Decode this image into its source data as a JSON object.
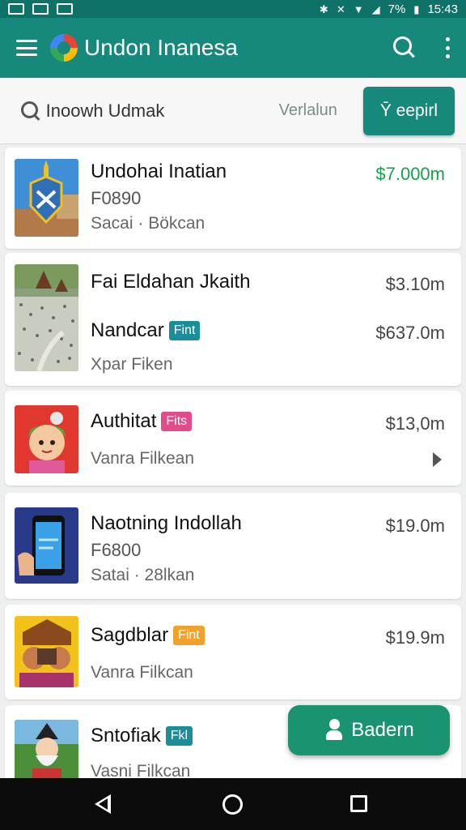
{
  "status_bar": {
    "left_icons": [
      "image-notification-icon",
      "n-notification-icon",
      "cast-notification-icon"
    ],
    "battery": "7%",
    "time": "15:43"
  },
  "app_bar": {
    "title": "Undon Inanesa",
    "icons": [
      "menu-icon",
      "app-logo-icon",
      "search-icon",
      "more-vert-icon"
    ]
  },
  "search": {
    "placeholder": "Inoowh Udmak",
    "filter_label": "Verlalun",
    "button_label": "Ȳ eepirl"
  },
  "listings": [
    {
      "title": "Undohai Inatian",
      "line2": "F0890",
      "line3": "Sacai · Bökcan",
      "price": "$7.000m",
      "price_color": "#13a34b"
    },
    {
      "title": "Fai Eldahan Jkaith",
      "price": "$3.10m",
      "line2": "Nandcar",
      "badge": "Fint",
      "badge_color": "#1a8f9a",
      "price2": "$637.0m",
      "line3": "Xpar Fiken"
    },
    {
      "title": "Authitat",
      "badge": "Fits",
      "badge_color": "#e24b8a",
      "price": "$13,0m",
      "line3": "Vanra Filkean",
      "trailing_icon": "chevron-right-icon"
    },
    {
      "title": "Naotning Indollah",
      "price": "$19.0m",
      "line2": "F6800",
      "line3": "Satai · 28lkan"
    },
    {
      "title": "Sagdblar",
      "badge": "Fint",
      "badge_color": "#f0a22a",
      "price": "$19.9m",
      "line3": "Vanra Filkcan"
    },
    {
      "title": "Sntofiak",
      "badge": "Fkl",
      "badge_color": "#1a8f9a",
      "line3": "Vasni Filkcan"
    }
  ],
  "fab": {
    "label": "Badern",
    "icon": "person-icon"
  },
  "nav_bar": {
    "icons": [
      "back-icon",
      "home-icon",
      "recents-icon"
    ]
  }
}
